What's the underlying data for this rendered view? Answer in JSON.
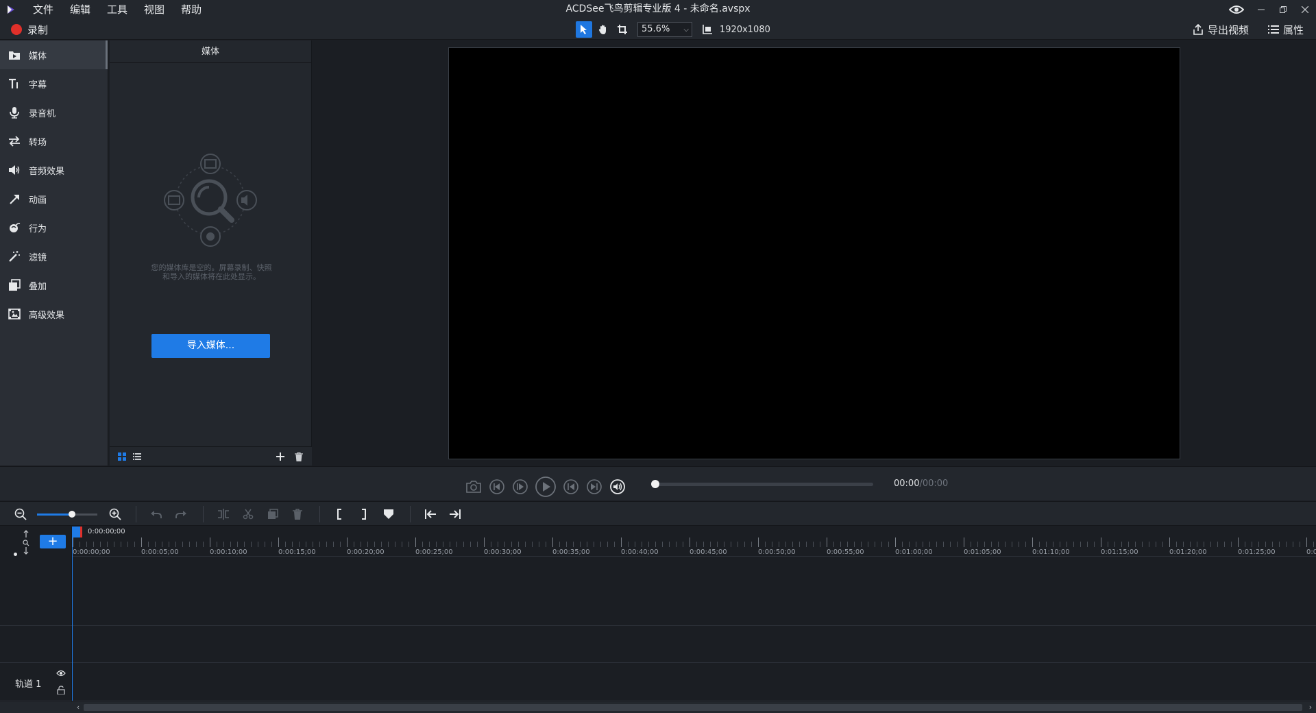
{
  "titlebar": {
    "window_title": "ACDSee飞鸟剪辑专业版 4 - 未命名.avspx",
    "menu": [
      "文件",
      "编辑",
      "工具",
      "视图",
      "帮助"
    ]
  },
  "toolbar": {
    "record_label": "录制",
    "zoom_value": "55.6%",
    "resolution": "1920x1080",
    "export_label": "导出视频",
    "properties_label": "属性"
  },
  "leftnav": {
    "items": [
      {
        "label": "媒体",
        "icon": "media-icon"
      },
      {
        "label": "字幕",
        "icon": "text-icon"
      },
      {
        "label": "录音机",
        "icon": "microphone-icon"
      },
      {
        "label": "转场",
        "icon": "transition-icon"
      },
      {
        "label": "音频效果",
        "icon": "speaker-icon"
      },
      {
        "label": "动画",
        "icon": "arrow-icon"
      },
      {
        "label": "行为",
        "icon": "behavior-icon"
      },
      {
        "label": "滤镜",
        "icon": "magic-wand-icon"
      },
      {
        "label": "叠加",
        "icon": "overlay-icon"
      },
      {
        "label": "高级效果",
        "icon": "advanced-effects-icon"
      }
    ]
  },
  "media": {
    "header": "媒体",
    "empty_text": "您的媒体库是空的。屏幕录制、快照和导入的媒体将在此处显示。",
    "import_label": "导入媒体..."
  },
  "playback": {
    "current_time": "00:00",
    "separator": "/",
    "total_time": "00:00",
    "progress": 0
  },
  "timeline": {
    "playhead_time": "0:00:00;00",
    "ruler_labels": [
      "0:00:00;00",
      "0:00:05;00",
      "0:00:10;00",
      "0:00:15;00",
      "0:00:20;00",
      "0:00:25;00",
      "0:00:30;00",
      "0:00:35;00",
      "0:00:40;00",
      "0:00:45;00",
      "0:00:50;00",
      "0:00:55;00",
      "0:01:00;00",
      "0:01:05;00",
      "0:01:10;00",
      "0:01:15;00",
      "0:01:20;00",
      "0:01:25;00",
      "0:0"
    ],
    "track_label": "轨道 1"
  },
  "colors": {
    "accent": "#1f7be6",
    "record": "#e0302a",
    "background": "#1b1e23",
    "panel": "#23272d"
  }
}
